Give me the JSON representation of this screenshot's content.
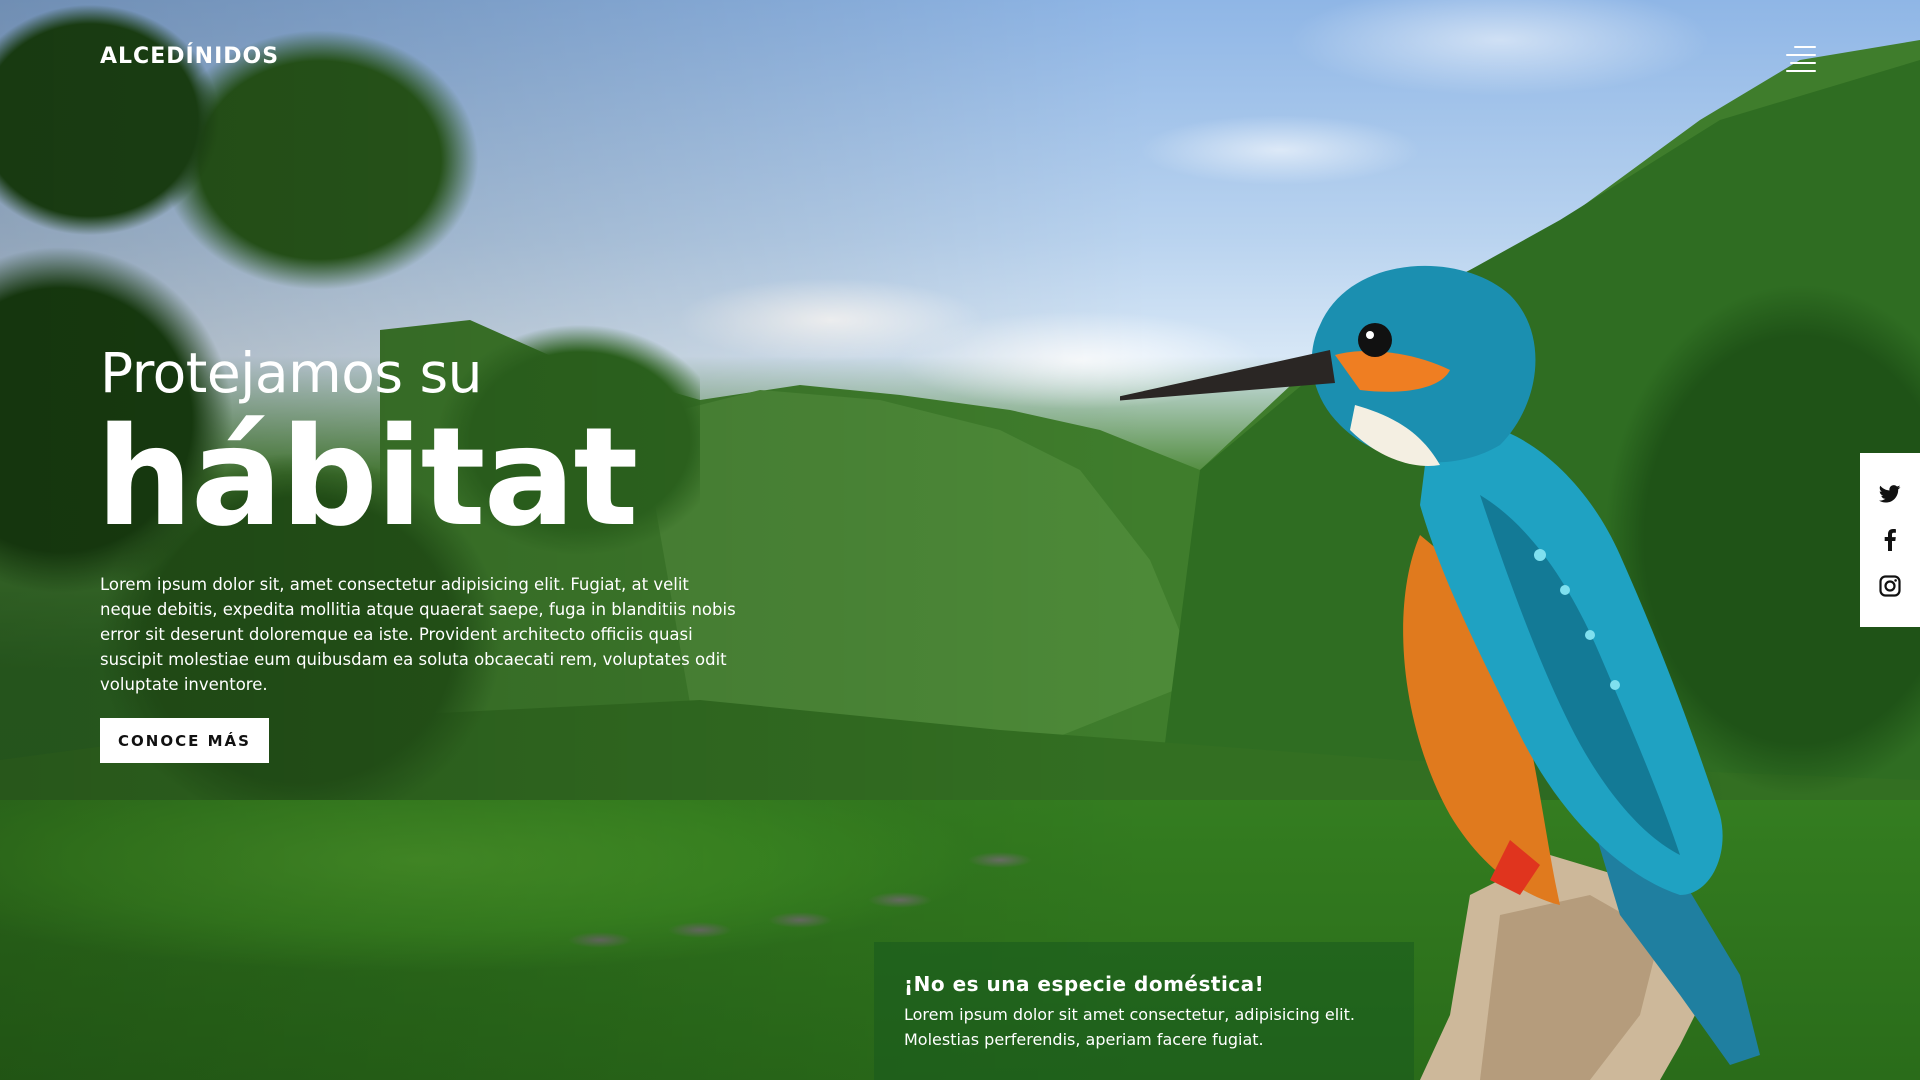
{
  "header": {
    "logo_text": "ALCEDÍNIDOS",
    "menu_icon": "hamburger-menu-icon"
  },
  "hero": {
    "subtitle": "Protejamos su",
    "title": "hábitat",
    "description": "Lorem ipsum dolor sit, amet consectetur adipisicing elit. Fugiat, at velit neque debitis, expedita mollitia atque quaerat saepe, fuga in blanditiis nobis error sit deserunt doloremque ea iste. Provident architecto officiis quasi suscipit molestiae eum quibusdam ea soluta obcaecati rem, voluptates odit voluptate inventore.",
    "cta_label": "CONOCE MÁS"
  },
  "social": {
    "items": [
      {
        "icon": "twitter-icon"
      },
      {
        "icon": "facebook-icon"
      },
      {
        "icon": "instagram-icon"
      }
    ]
  },
  "info_box": {
    "title": "¡No es una especie doméstica!",
    "text": "Lorem ipsum dolor sit amet consectetur, adipisicing elit. Molestias perferendis, aperiam facere fugiat."
  },
  "colors": {
    "text": "#ffffff",
    "button_bg": "#ffffff",
    "button_text": "#111111",
    "social_bar_bg": "#ffffff",
    "info_box_bg": "#185a1e"
  }
}
